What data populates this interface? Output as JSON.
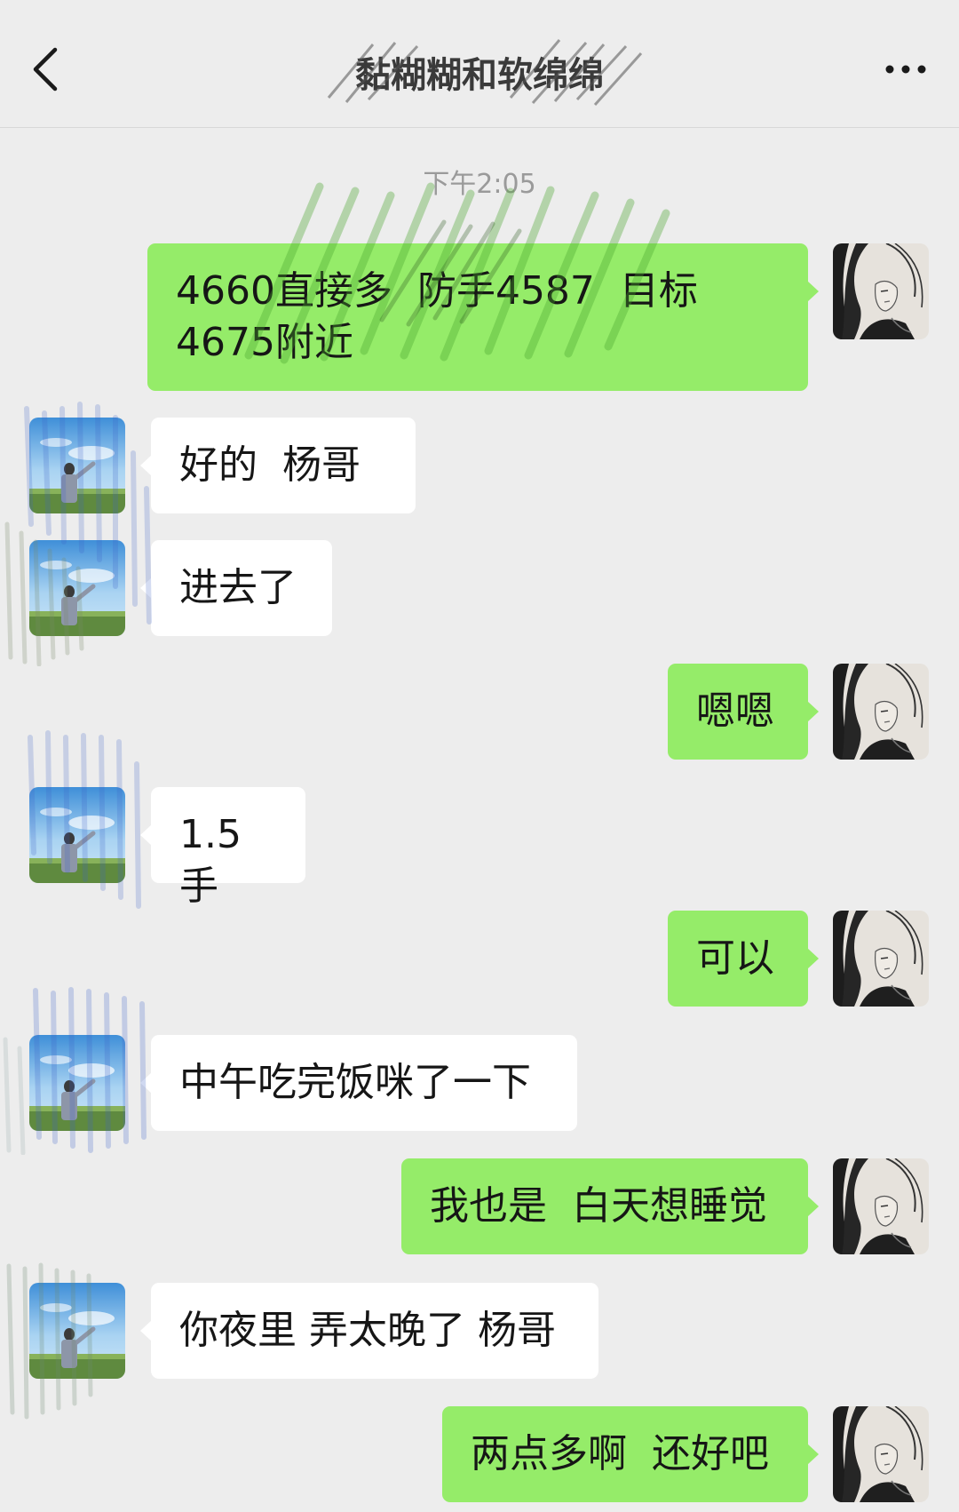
{
  "header": {
    "title": "黏糊糊和软绵绵",
    "back_icon": "chevron-left-icon",
    "more_icon": "more-horizontal-icon"
  },
  "chat": {
    "timestamp": "下午2:05",
    "messages": [
      {
        "from": "me",
        "text": "4660直接多  防手4587  目标\n4675附近"
      },
      {
        "from": "other",
        "text": "好的  杨哥"
      },
      {
        "from": "other",
        "text": "进去了"
      },
      {
        "from": "me",
        "text": "嗯嗯"
      },
      {
        "from": "other",
        "text": "1.5手"
      },
      {
        "from": "me",
        "text": "可以"
      },
      {
        "from": "other",
        "text": "中午吃完饭咪了一下"
      },
      {
        "from": "me",
        "text": "我也是  白天想睡觉"
      },
      {
        "from": "other",
        "text": "你夜里 弄太晚了 杨哥"
      },
      {
        "from": "me",
        "text": "两点多啊  还好吧"
      }
    ]
  },
  "colors": {
    "background": "#ededed",
    "outgoing_bubble": "#95ec69",
    "incoming_bubble": "#ffffff",
    "text": "#161616",
    "timestamp": "#9a9a9a"
  }
}
